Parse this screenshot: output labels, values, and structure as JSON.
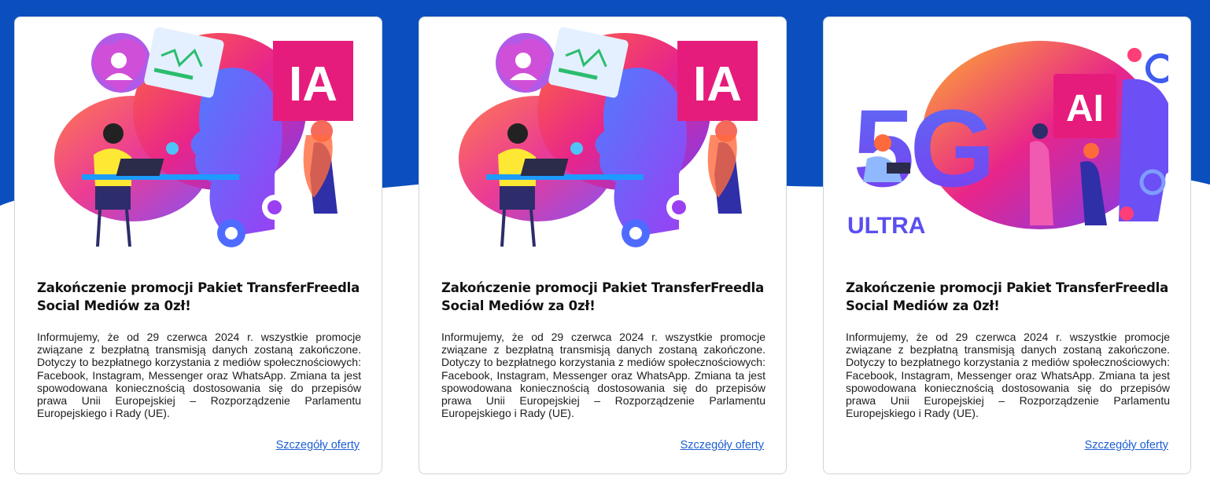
{
  "colors": {
    "band": "#0b4fbf",
    "link": "#1d5fd6",
    "magenta": "#e61c7c",
    "purple": "#6a3df0"
  },
  "cards": [
    {
      "title": "Zakończenie promocji  Pakiet TransferFreedla Social Mediów za 0zł!",
      "body": "Informujemy, że od 29 czerwca 2024 r. wszystkie promocje związane z bezpłatną transmisją danych zostaną zakończone. Dotyczy to bezpłatnego korzystania z mediów społecznościowych: Facebook, Instagram, Messenger oraz WhatsApp. Zmiana ta jest spowodowana koniecznością dostosowania się do przepisów prawa Unii Europejskiej – Rozporządzenie Parlamentu Europejskiego i Rady (UE).",
      "link": "Szczegóły oferty",
      "art": {
        "sign": "IA"
      }
    },
    {
      "title": "Zakończenie promocji  Pakiet TransferFreedla Social Mediów za 0zł!",
      "body": "Informujemy, że od 29 czerwca 2024 r. wszystkie promocje związane z bezpłatną transmisją danych zostaną zakończone. Dotyczy to bezpłatnego korzystania z mediów społecznościowych: Facebook, Instagram, Messenger oraz WhatsApp. Zmiana ta jest spowodowana koniecznością dostosowania się do przepisów prawa Unii Europejskiej – Rozporządzenie Parlamentu Europejskiego i Rady (UE).",
      "link": "Szczegóły oferty",
      "art": {
        "sign": "IA"
      }
    },
    {
      "title": "Zakończenie promocji  Pakiet TransferFreedla Social Mediów za 0zł!",
      "body": "Informujemy, że od 29 czerwca 2024 r. wszystkie promocje związane z bezpłatną transmisją danych zostaną zakończone. Dotyczy to bezpłatnego korzystania z mediów społecznościowych: Facebook, Instagram, Messenger oraz WhatsApp. Zmiana ta jest spowodowana koniecznością dostosowania się do przepisów prawa Unii Europejskiej – Rozporządzenie Parlamentu Europejskiego i Rady (UE).",
      "link": "Szczegóły oferty",
      "art": {
        "big": "5G",
        "sign": "AI",
        "tag": "ULTRA"
      }
    }
  ]
}
